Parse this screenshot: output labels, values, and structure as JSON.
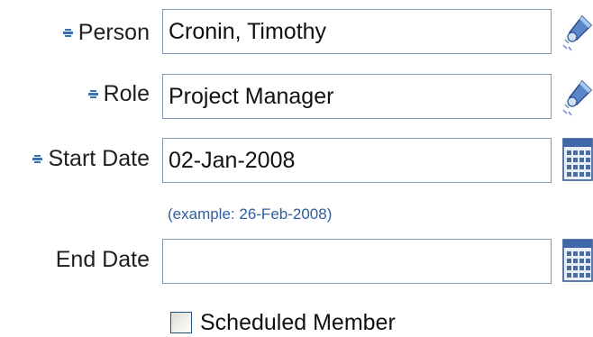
{
  "form": {
    "person": {
      "label": "Person",
      "value": "Cronin, Timothy",
      "required": true,
      "icon": "search-flashlight-icon"
    },
    "role": {
      "label": "Role",
      "value": "Project Manager",
      "required": true,
      "icon": "search-flashlight-icon"
    },
    "start_date": {
      "label": "Start Date",
      "value": "02-Jan-2008",
      "required": true,
      "icon": "calendar-icon",
      "hint": "(example: 26-Feb-2008)"
    },
    "end_date": {
      "label": "End Date",
      "value": "",
      "required": false,
      "icon": "calendar-icon"
    },
    "scheduled_member": {
      "label": "Scheduled Member",
      "checked": false
    }
  },
  "colors": {
    "field_border": "#7f9db9",
    "hint": "#2e5f9e",
    "required_marker": "#3a6fb0"
  }
}
